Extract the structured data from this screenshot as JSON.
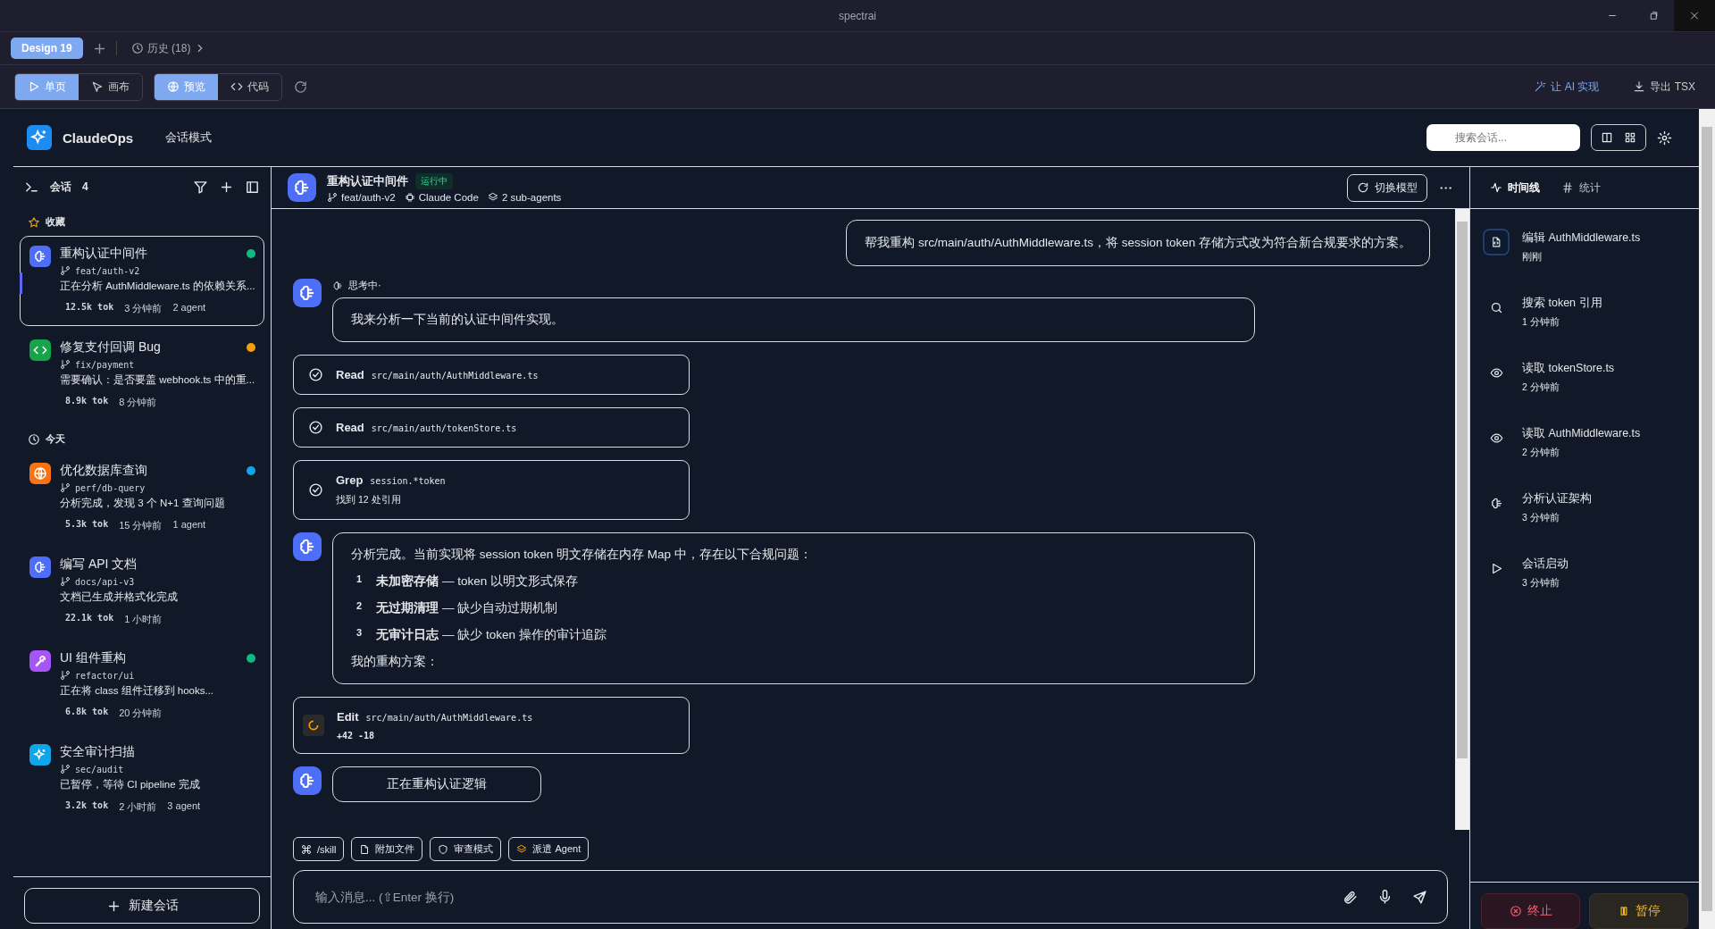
{
  "window": {
    "title": "spectrai"
  },
  "tabs": [
    {
      "label": "Design 19",
      "selected": true
    }
  ],
  "history": {
    "label": "历史 (18)"
  },
  "toolbar": {
    "view_modes": [
      {
        "label": "单页",
        "selected": true
      },
      {
        "label": "画布",
        "selected": false
      }
    ],
    "display_modes": [
      {
        "label": "预览",
        "selected": true
      },
      {
        "label": "代码",
        "selected": false
      }
    ],
    "actions": [
      {
        "label": "让 AI 实现",
        "kind": "primary"
      },
      {
        "label": "导出 TSX",
        "kind": "plain"
      }
    ]
  },
  "app": {
    "name": "ClaudeOps",
    "mode": "会话模式",
    "search": {
      "placeholder": "搜索会话..."
    }
  },
  "sidebar": {
    "title": "会话",
    "count": "4",
    "new_button": "新建会话",
    "groups": [
      {
        "label": "收藏",
        "kind": "star",
        "sessions": [
          {
            "title": "重构认证中间件",
            "kind": "brain",
            "branch": "feat/auth-v2",
            "preview": "正在分析 AuthMiddleware.ts 的依赖关系...",
            "tokens": "12.5k tok",
            "time": "3 分钟前",
            "agents": "2 agent",
            "color": "#10b981",
            "selected": true
          },
          {
            "title": "修复支付回调 Bug",
            "kind": "code",
            "branch": "fix/payment",
            "preview": "需要确认：是否要盖 webhook.ts 中的重...",
            "tokens": "8.9k tok",
            "time": "8 分钟前",
            "color": "#f59e0b",
            "selected": false
          }
        ]
      },
      {
        "label": "今天",
        "kind": "clock",
        "sessions": [
          {
            "title": "优化数据库查询",
            "kind": "globe",
            "branch": "perf/db-query",
            "preview": "分析完成，发现 3 个 N+1 查询问题",
            "tokens": "5.3k tok",
            "time": "15 分钟前",
            "agents": "1 agent",
            "color": "#0ea5e9",
            "selected": false
          },
          {
            "title": "编写 API 文档",
            "kind": "brain",
            "branch": "docs/api-v3",
            "preview": "文档已生成并格式化完成",
            "tokens": "22.1k tok",
            "time": "1 小时前",
            "selected": false
          },
          {
            "title": "UI 组件重构",
            "kind": "wrench",
            "branch": "refactor/ui",
            "preview": "正在将 class 组件迁移到 hooks...",
            "tokens": "6.8k tok",
            "time": "20 分钟前",
            "color": "#10b981",
            "selected": false
          },
          {
            "title": "安全审计扫描",
            "kind": "sparkle",
            "branch": "sec/audit",
            "preview": "已暂停，等待 CI pipeline 完成",
            "tokens": "3.2k tok",
            "time": "2 小时前",
            "agents": "3 agent",
            "selected": false
          }
        ]
      }
    ]
  },
  "chat": {
    "title": "重构认证中间件",
    "status": "运行中",
    "branch": "feat/auth-v2",
    "engine": "Claude Code",
    "agents": "2 sub-agents",
    "switch_button": "切换模型",
    "messages": [
      {
        "kind": "user",
        "text": "帮我重构 src/main/auth/AuthMiddleware.ts，将 session token 存储方式改为符合新合规要求的方案。"
      },
      {
        "kind": "assistant",
        "label": "思考中·",
        "text": "我来分析一下当前的认证中间件实现。"
      },
      {
        "kind": "tool",
        "name": "Read",
        "arg": "src/main/auth/AuthMiddleware.ts",
        "done": true
      },
      {
        "kind": "tool",
        "name": "Read",
        "arg": "src/main/auth/tokenStore.ts",
        "done": true
      },
      {
        "kind": "tool",
        "name": "Grep",
        "arg": "session.*token",
        "result": "找到 12 处引用",
        "done": true
      },
      {
        "kind": "assistant",
        "text": "分析完成。当前实现将 session token 明文存储在内存 Map 中，存在以下合规问题：",
        "items": [
          {
            "num": "1",
            "text": "**未加密存储** — token 以明文形式保存"
          },
          {
            "num": "2",
            "text": "**无过期清理** — 缺少自动过期机制"
          },
          {
            "num": "3",
            "text": "**无审计日志** — 缺少 token 操作的审计追踪"
          }
        ],
        "outro": "我的重构方案："
      },
      {
        "kind": "tool",
        "name": "Edit",
        "arg": "src/main/auth/AuthMiddleware.ts",
        "result": "+42 -18",
        "done": false
      },
      {
        "kind": "assistant",
        "text": "正在重构认证逻辑"
      }
    ],
    "quick_actions": [
      {
        "label": "/skill"
      },
      {
        "label": "附加文件"
      },
      {
        "label": "审查模式"
      },
      {
        "label": "派遣 Agent"
      }
    ],
    "composer": {
      "placeholder": "输入消息... (⇧Enter 换行)"
    }
  },
  "panel": {
    "tabs": [
      {
        "label": "时间线",
        "selected": true
      },
      {
        "label": "统计",
        "selected": false
      }
    ],
    "timeline": [
      {
        "text": "编辑 AuthMiddleware.ts",
        "time": "刚刚",
        "kind": "filecode",
        "active": true
      },
      {
        "text": "搜索 token 引用",
        "time": "1 分钟前",
        "kind": "search",
        "active": false
      },
      {
        "text": "读取 tokenStore.ts",
        "time": "2 分钟前",
        "kind": "eye",
        "active": false
      },
      {
        "text": "读取 AuthMiddleware.ts",
        "time": "2 分钟前",
        "kind": "eye",
        "active": false
      },
      {
        "text": "分析认证架构",
        "time": "3 分钟前",
        "kind": "brain",
        "active": false
      },
      {
        "text": "会话启动",
        "time": "3 分钟前",
        "kind": "play",
        "active": false
      }
    ],
    "buttons": [
      {
        "label": "终止",
        "kind": "danger"
      },
      {
        "label": "暂停",
        "kind": "warning"
      }
    ]
  }
}
